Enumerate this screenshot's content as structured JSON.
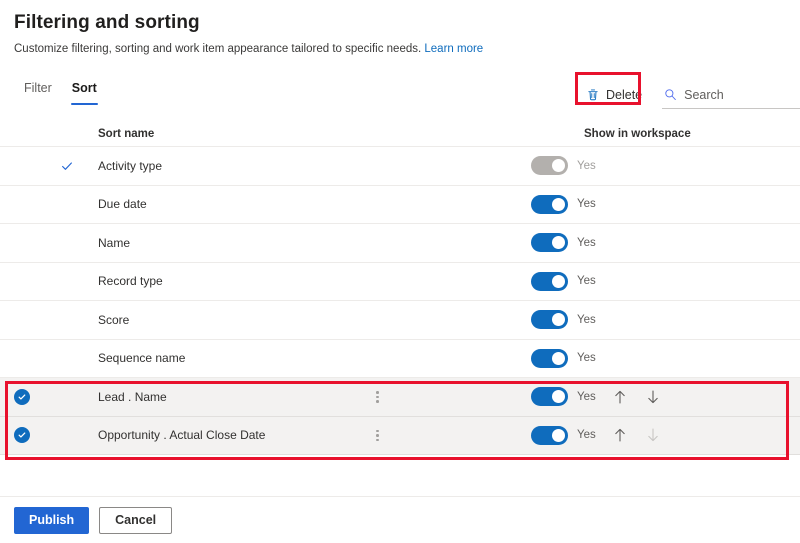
{
  "header": {
    "title": "Filtering and sorting",
    "subtitle": "Customize filtering, sorting and work item appearance tailored to specific needs.",
    "learn_more": "Learn more"
  },
  "command_bar": {
    "tabs": [
      {
        "label": "Filter",
        "active": false
      },
      {
        "label": "Sort",
        "active": true
      }
    ],
    "delete_label": "Delete",
    "delete_icon": "trash-icon",
    "search_placeholder": "Search",
    "search_value": "",
    "search_icon": "search-icon"
  },
  "table": {
    "columns": {
      "sort_name": "Sort name",
      "show_in_workspace": "Show in workspace"
    },
    "rows": [
      {
        "name": "Activity type",
        "selected": false,
        "marker": "check",
        "has_menu": false,
        "toggle_on": true,
        "toggle_disabled": true,
        "toggle_label": "Yes",
        "has_arrows": false,
        "arrow_up_disabled": false,
        "arrow_down_disabled": false
      },
      {
        "name": "Due date",
        "selected": false,
        "marker": "none",
        "has_menu": false,
        "toggle_on": true,
        "toggle_disabled": false,
        "toggle_label": "Yes",
        "has_arrows": false,
        "arrow_up_disabled": false,
        "arrow_down_disabled": false
      },
      {
        "name": "Name",
        "selected": false,
        "marker": "none",
        "has_menu": false,
        "toggle_on": true,
        "toggle_disabled": false,
        "toggle_label": "Yes",
        "has_arrows": false,
        "arrow_up_disabled": false,
        "arrow_down_disabled": false
      },
      {
        "name": "Record type",
        "selected": false,
        "marker": "none",
        "has_menu": false,
        "toggle_on": true,
        "toggle_disabled": false,
        "toggle_label": "Yes",
        "has_arrows": false,
        "arrow_up_disabled": false,
        "arrow_down_disabled": false
      },
      {
        "name": "Score",
        "selected": false,
        "marker": "none",
        "has_menu": false,
        "toggle_on": true,
        "toggle_disabled": false,
        "toggle_label": "Yes",
        "has_arrows": false,
        "arrow_up_disabled": false,
        "arrow_down_disabled": false
      },
      {
        "name": "Sequence name",
        "selected": false,
        "marker": "none",
        "has_menu": false,
        "toggle_on": true,
        "toggle_disabled": false,
        "toggle_label": "Yes",
        "has_arrows": false,
        "arrow_up_disabled": false,
        "arrow_down_disabled": false
      },
      {
        "name": "Lead . Name",
        "selected": true,
        "marker": "checkbox",
        "has_menu": true,
        "toggle_on": true,
        "toggle_disabled": false,
        "toggle_label": "Yes",
        "has_arrows": true,
        "arrow_up_disabled": false,
        "arrow_down_disabled": false
      },
      {
        "name": "Opportunity . Actual Close Date",
        "selected": true,
        "marker": "checkbox",
        "has_menu": true,
        "toggle_on": true,
        "toggle_disabled": false,
        "toggle_label": "Yes",
        "has_arrows": true,
        "arrow_up_disabled": false,
        "arrow_down_disabled": true
      }
    ]
  },
  "footer": {
    "publish_label": "Publish",
    "cancel_label": "Cancel"
  },
  "colors": {
    "accent_blue": "#2266d3",
    "toggle_on": "#0f6cbd",
    "toggle_disabled": "#b3b0ad",
    "link": "#0f6cbd",
    "annotation_red": "#e8112d",
    "selected_row": "#f3f2f1"
  },
  "annotations": [
    {
      "name": "delete-button-highlight",
      "target": "Delete"
    },
    {
      "name": "selected-rows-highlight",
      "target": "Lead . Name, Opportunity . Actual Close Date"
    }
  ]
}
